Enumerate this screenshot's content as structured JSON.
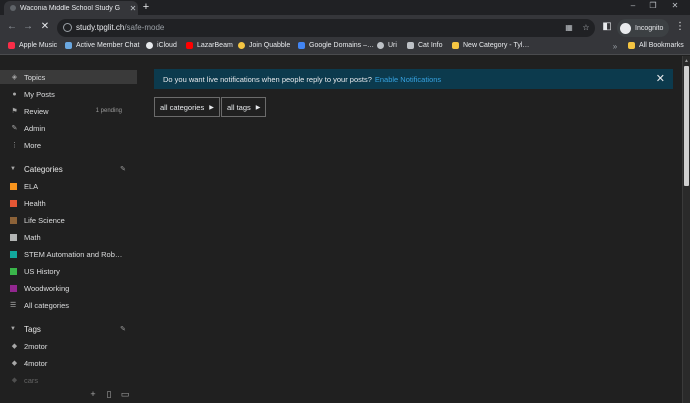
{
  "browser": {
    "tab_title": "Waconia Middle School Study G",
    "new_tab": "+",
    "url_host": "study.tpglit.ch",
    "url_path": "/safe-mode",
    "incognito_label": "Incognito",
    "win_controls": [
      "–",
      "❐",
      "✕"
    ],
    "nav": {
      "back": "←",
      "forward": "→",
      "reload": "✕"
    }
  },
  "bookmarks": [
    {
      "label": "Apple Music",
      "color": "#fa2d48"
    },
    {
      "label": "Active Member Chat",
      "color": "#6aa7e0"
    },
    {
      "label": "iCloud",
      "color": "#e8eaed"
    },
    {
      "label": "LazarBeam",
      "color": "#ff0000"
    },
    {
      "label": "Join Quabble",
      "color": "#f5c542"
    },
    {
      "label": "Google Domains –…",
      "color": "#4285f4"
    },
    {
      "label": "Uri",
      "color": "#bdc1c6"
    },
    {
      "label": "Cat Info",
      "color": "#bdc1c6"
    },
    {
      "label": "New Category - Tyl…",
      "color": "#f5c542"
    },
    {
      "label": "All Bookmarks",
      "color": "#f5c542"
    }
  ],
  "sidebar": {
    "nav": [
      {
        "label": "Topics",
        "icon": "stack-icon"
      },
      {
        "label": "My Posts",
        "icon": "user-icon"
      },
      {
        "label": "Review",
        "icon": "flag-icon",
        "badge": "1 pending"
      },
      {
        "label": "Admin",
        "icon": "wrench-icon"
      },
      {
        "label": "More",
        "icon": "ellipsis-icon"
      }
    ],
    "categories_heading": "Categories",
    "categories": [
      {
        "label": "ELA",
        "color": "#f7941d"
      },
      {
        "label": "Health",
        "color": "#e45735"
      },
      {
        "label": "Life Science",
        "color": "#8c6238"
      },
      {
        "label": "Math",
        "color": "#b3b5b4"
      },
      {
        "label": "STEM Automation and Rob…",
        "color": "#12a89d"
      },
      {
        "label": "US History",
        "color": "#3ab54a"
      },
      {
        "label": "Woodworking",
        "color": "#92278f"
      },
      {
        "label": "All categories",
        "color": ""
      }
    ],
    "tags_heading": "Tags",
    "tags": [
      "2motor",
      "4motor",
      "cars"
    ]
  },
  "main": {
    "banner_text": "Do you want live notifications when people reply to your posts?",
    "banner_link": "Enable Notifications",
    "banner_close": "✕",
    "filters": [
      "all categories",
      "all tags"
    ]
  }
}
